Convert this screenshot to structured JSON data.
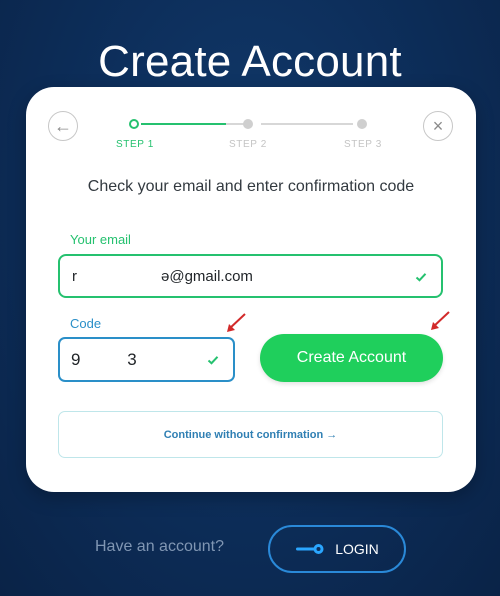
{
  "page": {
    "title": "Create Account"
  },
  "nav": {
    "back_icon": "arrow-left-icon",
    "close_icon": "close-icon"
  },
  "steps": [
    {
      "label": "STEP 1",
      "state": "active"
    },
    {
      "label": "STEP 2",
      "state": "inactive"
    },
    {
      "label": "STEP 3",
      "state": "inactive"
    }
  ],
  "form": {
    "instruction": "Check your email and enter confirmation code",
    "email": {
      "label": "Your email",
      "value_left": "r",
      "value_right": "ə@gmail.com"
    },
    "code": {
      "label": "Code",
      "value": "9        3"
    },
    "create_button_label": "Create Account",
    "continue_label": "Continue without confirmation →"
  },
  "footer": {
    "have_account_text": "Have an account?",
    "login_label": "LOGIN",
    "login_icon": "key-icon"
  },
  "colors": {
    "accent_green": "#25c16f",
    "accent_blue": "#2a8fc8",
    "background": "#0d2f5c",
    "annotation_red": "#d22a2a"
  }
}
